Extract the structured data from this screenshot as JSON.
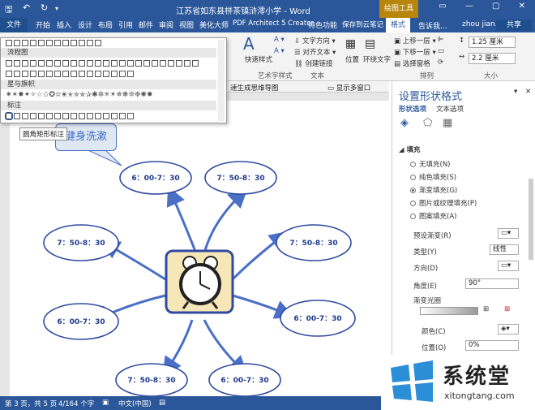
{
  "titlebar": {
    "doc_title": "江苏省如东县栟茶镇浒澪小学 - Word",
    "drawing_tools": "绘图工具",
    "quick_access": [
      "save-icon",
      "undo-icon",
      "redo-icon"
    ]
  },
  "tabs": [
    "文件",
    "开始",
    "插入",
    "设计",
    "布局",
    "引用",
    "邮件",
    "审阅",
    "视图",
    "美化大师",
    "PDF Architect 5 Creator",
    "特色功能",
    "保存到云笔记",
    "格式"
  ],
  "tellme": "告诉我...",
  "user": "zhou jian...",
  "share": "共享",
  "ribbon": {
    "art_styles_btn": "快速样式",
    "art_group": "艺术字样式",
    "text_dir": "文字方向",
    "align_text": "对齐文本",
    "create_link": "创建链接",
    "text_group": "文本",
    "position": "位置",
    "wrap": "环绕文字",
    "bring_forward": "上移一层",
    "send_backward": "下移一层",
    "select_pane": "选择窗格",
    "arrange_group": "排列",
    "height": "1.25 厘米",
    "width": "2.2 厘米",
    "size_group": "大小"
  },
  "gallery": {
    "sec_flow": "流程图",
    "sec_stars": "星与旗帜",
    "sec_callout": "标注",
    "tooltip": "圆角矩形标注"
  },
  "docbar": {
    "left": "速生成思维导图",
    "right": "显示多窗口"
  },
  "canvas": {
    "callout_text": "健身洗漱",
    "times": [
      "6：00-7：30",
      "7：50-8：30",
      "7：50-8：30",
      "7：50-8：30",
      "6：00-7：30",
      "6：00-7：30",
      "7：50-8：30",
      "6：00-7：30"
    ],
    "colors": {
      "ellipse_stroke": "#2f4aa0",
      "text": "#1f3b8c",
      "branch": "#4a6fc7",
      "clock_bg": "#f6e7b8"
    }
  },
  "pane": {
    "title": "设置形状格式",
    "tab_shape": "形状选项",
    "tab_text": "文本选项",
    "fill_section": "填充",
    "fill_options": [
      "无填充(N)",
      "纯色填充(S)",
      "渐变填充(G)",
      "图片或纹理填充(P)",
      "图案填充(A)"
    ],
    "selected_fill": 2,
    "preset": "预设渐变(R)",
    "type_label": "类型(Y)",
    "type_value": "线性",
    "direction": "方向(D)",
    "angle_label": "角度(E)",
    "angle_value": "90°",
    "stops_label": "渐变光圈",
    "color_label": "颜色(C)",
    "position_label": "位置(O)",
    "position_value": "0%"
  },
  "status": {
    "page": "第 3 页，共 5 页",
    "words": "4/164 个字",
    "lang": "中文(中国)"
  },
  "watermark": {
    "brand": "系统堂",
    "url": "xitongtang.com"
  }
}
